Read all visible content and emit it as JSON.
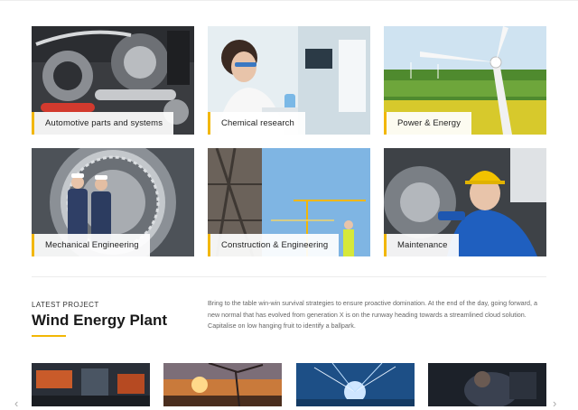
{
  "services": [
    {
      "label": "Automotive parts and systems"
    },
    {
      "label": "Chemical research"
    },
    {
      "label": "Power & Energy"
    },
    {
      "label": "Mechanical Engineering"
    },
    {
      "label": "Construction & Engineering"
    },
    {
      "label": "Maintenance"
    }
  ],
  "project": {
    "kicker": "LATEST PROJECT",
    "title": "Wind Energy Plant",
    "description": "Bring to the table win-win survival strategies to ensure proactive domination. At the end of the day, going forward, a new normal that has evolved from generation X is on the runway heading towards a streamlined cloud solution. Capitalise on low hanging fruit to identify a ballpark."
  },
  "carousel": {
    "prev": "‹",
    "next": "›"
  },
  "colors": {
    "accent": "#f2b705"
  }
}
